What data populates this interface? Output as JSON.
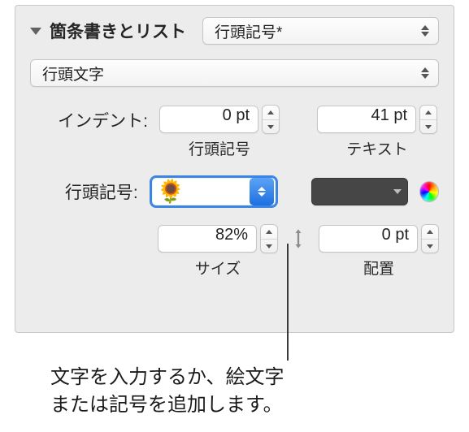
{
  "header": {
    "title": "箇条書きとリスト",
    "style_popup": "行頭記号*"
  },
  "bullet_type_popup": "行頭文字",
  "indent": {
    "label": "インデント:",
    "bullet_value": "0 pt",
    "bullet_sublabel": "行頭記号",
    "text_value": "41 pt",
    "text_sublabel": "テキスト"
  },
  "bullet_picker": {
    "label": "行頭記号:",
    "glyph": "🌻"
  },
  "size": {
    "value": "82%",
    "sublabel": "サイズ"
  },
  "align": {
    "value": "0 pt",
    "sublabel": "配置"
  },
  "callout": {
    "line1": "文字を入力するか、絵文字",
    "line2": "または記号を追加します。"
  }
}
